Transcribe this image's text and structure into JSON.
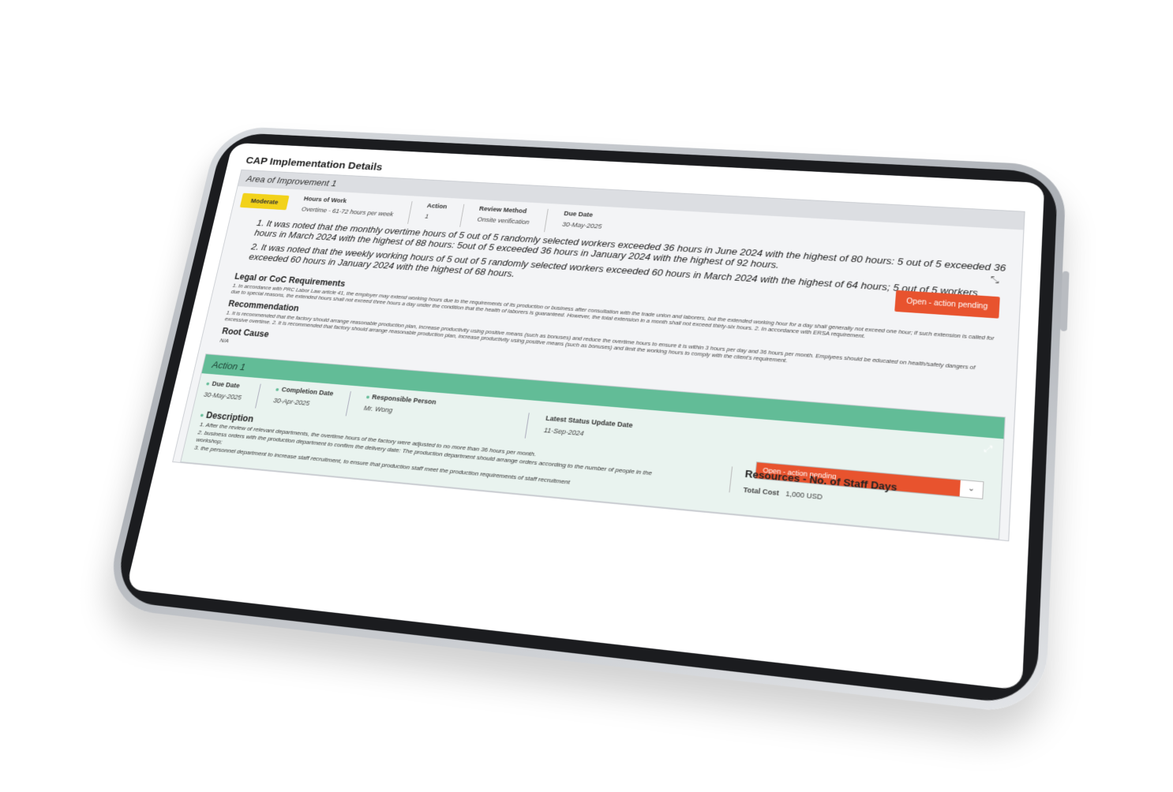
{
  "page": {
    "title": "CAP Implementation Details"
  },
  "area": {
    "heading": "Area of Improvement 1",
    "severity": "Moderate",
    "severity_color": "#f2d21a",
    "meta": [
      {
        "label": "Hours of Work",
        "value": "Overtime - 61-72 hours per week"
      },
      {
        "label": "Action",
        "value": "1"
      },
      {
        "label": "Review Method",
        "value": "Onsite verification"
      },
      {
        "label": "Due Date",
        "value": "30-May-2025"
      }
    ],
    "status": "Open - action pending",
    "status_color": "#e8532e",
    "findings": [
      "1. It was noted that the monthly overtime hours of 5 out of 5 randomly selected workers exceeded 36 hours in June 2024 with the highest of 80 hours: 5 out of 5 exceeded 36 hours in March 2024 with the highest of 88 hours: 5out of 5 exceeded 36 hours in January 2024 with the highest of 92 hours.",
      "2. It was noted that the weekly working hours of 5 out of 5 randomly selected workers exceeded 60 hours in March 2024 with the highest of 64 hours; 5 out of 5 workers exceeded 60 hours in January 2024 with the highest of 68 hours."
    ],
    "legal_title": "Legal or CoC Requirements",
    "legal_text": "1. In accordance with PRC Labor Law article 41, the employer may extend working hours due to the requirements of its production or business after consultation with the trade union and laborers, but the extended working hour for a day shall generally not exceed one hour; if such extension is called for due to special reasons, the extended hours shall not exceed three hours a day under the condition that the health of laborers is guaranteed. However, the total extension in a month shall not exceed thirty-six hours. 2. In accordance with ERSA requirement.",
    "recommendation_title": "Recommendation",
    "recommendation_text": "1. It is recommended that the factory should arrange reasonable production plan, increase productivity using positive means (such as bonuses) and reduce the overtime hours to ensure it is within 3 hours per day and 36 hours per month. Emplyees should be educated on health/safety dangers of excessive overtime. 2. It is recommended that factory should arrange reasonable production plan, increase productivity using positive means (such as bonuses) and limit the working hours to comply with the client's requirement.",
    "root_cause_title": "Root Cause",
    "root_cause_text": "N/A"
  },
  "action": {
    "heading": "Action 1",
    "header_color": "#62bc97",
    "due_date_label": "Due Date",
    "due_date": "30-May-2025",
    "completion_label": "Completion Date",
    "completion_date": "30-Apr-2025",
    "responsible_label": "Responsible Person",
    "responsible": "Mr. Wong",
    "latest_label": "Latest Status Update Date",
    "latest_date": "11-Sep-2024",
    "status": "Open - action pending",
    "description_title": "Description",
    "description": [
      "1. After the review of relevant departments, the overtime hours of the factory were adjusted to no more than 36 hours per month.",
      "2. business orders with the production department to confirm the delivery date: The production department should arrange orders according to the number of people in the workshop;",
      "3. the personnel department to increase staff recruitment, to ensure that production staff meet the production requirements of staff recruitment"
    ],
    "resources_title": "Resources - No. of Staff Days",
    "total_cost_label": "Total Cost",
    "total_cost": "1,000 USD"
  }
}
